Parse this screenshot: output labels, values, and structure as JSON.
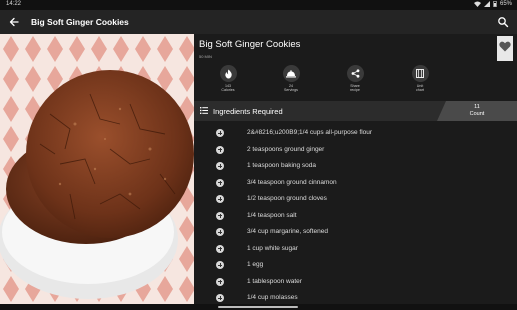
{
  "status_bar": {
    "time": "14:22",
    "battery": "65%"
  },
  "app_bar": {
    "title": "Big Soft Ginger Cookies"
  },
  "recipe": {
    "title": "Big Soft Ginger Cookies",
    "time": "50 MIN"
  },
  "actions": [
    {
      "label1": "143",
      "label2": "Calories",
      "icon": "flame-icon"
    },
    {
      "label1": "24",
      "label2": "Servings",
      "icon": "serving-dish-icon"
    },
    {
      "label1": "Share",
      "label2": "recipe",
      "icon": "share-icon"
    },
    {
      "label1": "Unit",
      "label2": "chart",
      "icon": "unit-chart-icon"
    }
  ],
  "ingredients": {
    "title": "Ingredients Required",
    "count": "11",
    "count_label": "Count",
    "items": [
      "2&#8216;u200B9;1/4 cups all-purpose flour",
      "2 teaspoons ground ginger",
      "1 teaspoon baking soda",
      "3/4 teaspoon ground cinnamon",
      "1/2 teaspoon ground cloves",
      "1/4 teaspoon salt",
      "3/4 cup margarine, softened",
      "1 cup white sugar",
      "1 egg",
      "1 tablespoon water",
      "1/4 cup molasses"
    ]
  },
  "colors": {
    "background": "#1b1b1b",
    "app_bar": "#242424",
    "header": "#2c2c2c",
    "count_badge": "#4a4a4a"
  }
}
